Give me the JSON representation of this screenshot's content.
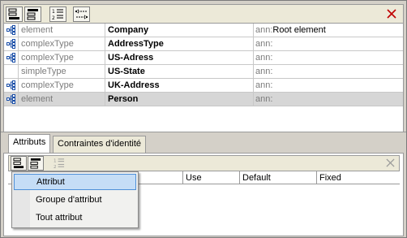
{
  "top_toolbar": {
    "buttons": [
      "append-row-icon",
      "insert-row-icon",
      "numbered-list-icon",
      "arrows-icon"
    ],
    "close_icon": "close-icon"
  },
  "components": [
    {
      "kind": "element",
      "name": "Company",
      "ann_prefix": "ann:",
      "ann_value": "Root element",
      "icon": "tree-node-icon"
    },
    {
      "kind": "complexType",
      "name": "AddressType",
      "ann_prefix": "ann:",
      "ann_value": "",
      "icon": "tree-node-icon"
    },
    {
      "kind": "complexType",
      "name": "US-Adress",
      "ann_prefix": "ann:",
      "ann_value": "",
      "icon": "tree-node-icon"
    },
    {
      "kind": "simpleType",
      "name": "US-State",
      "ann_prefix": "ann:",
      "ann_value": "",
      "icon": ""
    },
    {
      "kind": "complexType",
      "name": "UK-Address",
      "ann_prefix": "ann:",
      "ann_value": "",
      "icon": "tree-node-icon"
    },
    {
      "kind": "element",
      "name": "Person",
      "ann_prefix": "ann:",
      "ann_value": "",
      "icon": "tree-node-icon",
      "selected": true
    }
  ],
  "tabs": [
    {
      "label": "Attributs",
      "active": true
    },
    {
      "label": "Contraintes d'identité",
      "active": false
    }
  ],
  "attr_toolbar": {
    "buttons": [
      "append-attribute-icon",
      "insert-attribute-icon",
      "numbered-list-icon"
    ],
    "close_icon": "close-icon"
  },
  "attr_table": {
    "headers": [
      "Use",
      "Default",
      "Fixed"
    ]
  },
  "context_menu": {
    "items": [
      {
        "label": "Attribut",
        "hover": true
      },
      {
        "label": "Groupe d'attribut",
        "hover": false
      },
      {
        "label": "Tout attribut",
        "hover": false
      }
    ]
  }
}
